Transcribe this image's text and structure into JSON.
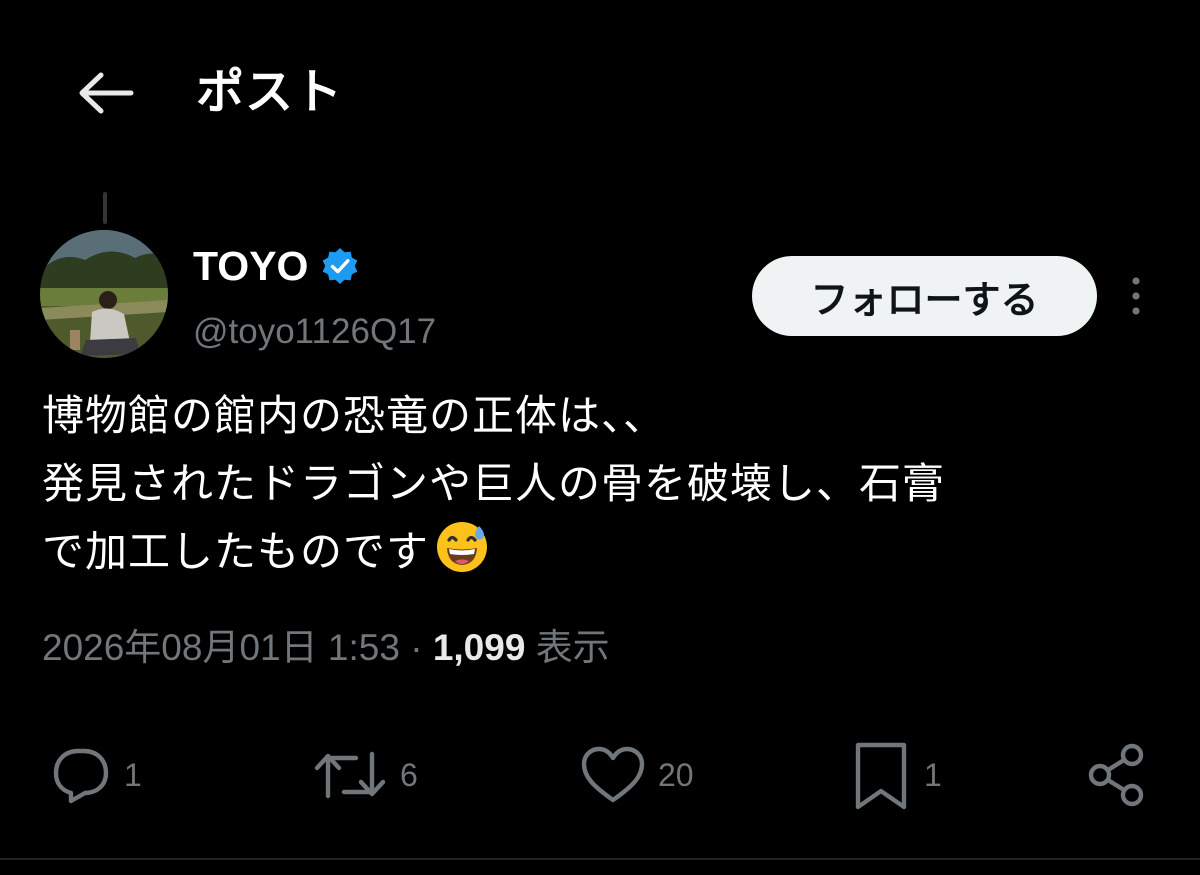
{
  "header": {
    "title": "ポスト",
    "back_icon": "arrow-left-icon"
  },
  "author": {
    "name": "TOYO",
    "handle": "@toyo1126Q17",
    "verified": true,
    "verified_color": "#1d9bf0"
  },
  "actions_top": {
    "follow_label": "フォローする",
    "more_icon": "more-vertical-icon"
  },
  "post": {
    "lines": [
      "博物館の館内の恐竜の正体は、、",
      "発見されたドラゴンや巨人の骨を破壊し、石膏",
      "で加工したものです"
    ],
    "emoji": "grinning-face-with-sweat-icon"
  },
  "meta": {
    "timestamp": "2026年08月01日 1:53",
    "separator": "·",
    "views_count": "1,099",
    "views_label": "表示"
  },
  "engagement": {
    "replies": "1",
    "reposts": "6",
    "likes": "20",
    "bookmarks": "1"
  },
  "colors": {
    "background": "#000000",
    "text_primary": "#e7e9ea",
    "text_secondary": "#71767b",
    "follow_bg": "#eff3f4",
    "accent": "#1d9bf0"
  }
}
